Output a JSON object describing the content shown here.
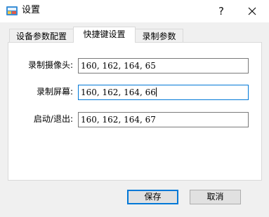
{
  "window": {
    "title": "设置",
    "help_glyph": "?",
    "app_icon": "settings-app-icon",
    "close_icon": "close-icon"
  },
  "tabs": [
    {
      "label": "设备参数配置",
      "active": false
    },
    {
      "label": "快捷键设置",
      "active": true
    },
    {
      "label": "录制参数",
      "active": false
    }
  ],
  "hotkeys": [
    {
      "label": "录制摄像头:",
      "value": "160, 162, 164, 65"
    },
    {
      "label": "录制屏幕:",
      "value": "160, 162, 164, 66"
    },
    {
      "label": "启动/退出:",
      "value": "160, 162, 164, 67"
    }
  ],
  "buttons": {
    "save": "保存",
    "cancel": "取消"
  },
  "colors": {
    "focus_accent": "#0078d7",
    "window_bg": "#f0f0f0",
    "panel_bg": "#ffffff"
  }
}
